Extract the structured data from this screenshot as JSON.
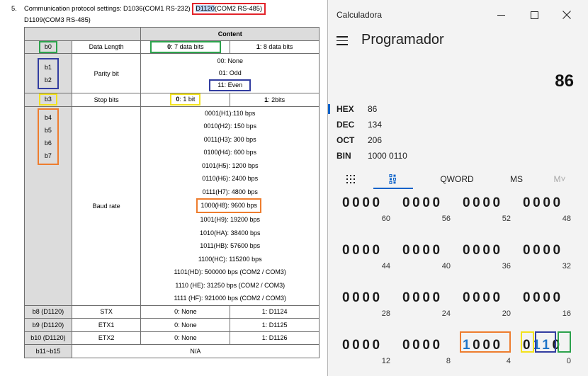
{
  "document": {
    "item_number": "5.",
    "intro_prefix": "Communication protocol settings: D1036(COM1 RS-232)",
    "intro_highlight_reg": "D1120",
    "intro_highlight_rest": "(COM2 RS-485)",
    "intro_line2": "D1109(COM3 RS-485)",
    "table": {
      "content_header": "Content",
      "b0": "b0",
      "data_length_label": "Data Length",
      "data_length_0": ": 7 data bits",
      "data_length_1": ": 8 data bits",
      "bit_zero": "0",
      "bit_one": "1",
      "b1": "b1",
      "b2": "b2",
      "parity_label": "Parity bit",
      "parity_options": [
        "00: None",
        "01: Odd",
        "11: Even"
      ],
      "b3": "b3",
      "stop_label": "Stop bits",
      "stop_0": ": 1 bit",
      "stop_1": ": 2bits",
      "b4": "b4",
      "b5": "b5",
      "b6": "b6",
      "b7": "b7",
      "baud_label": "Baud rate",
      "baud_rates": [
        "0001(H1):110 bps",
        "0010(H2): 150 bps",
        "0011(H3): 300 bps",
        "0100(H4): 600 bps",
        "0101(H5): 1200 bps",
        "0110(H6): 2400 bps",
        "0111(H7): 4800 bps",
        "1000(H8): 9600 bps",
        "1001(H9): 19200 bps",
        "1010(HA): 38400 bps",
        "1011(HB): 57600 bps",
        "1100(HC): 115200 bps",
        "1101(HD): 500000 bps (COM2 / COM3)",
        "1110 (HE): 31250 bps (COM2 / COM3)",
        "1111 (HF): 921000 bps (COM2 / COM3)"
      ],
      "rows_extra": [
        {
          "bit": "b8 (D1120)",
          "name": "STX",
          "zero": "0: None",
          "one": "1: D1124"
        },
        {
          "bit": "b9 (D1120)",
          "name": "ETX1",
          "zero": "0: None",
          "one": "1: D1125"
        },
        {
          "bit": "b10 (D1120)",
          "name": "ETX2",
          "zero": "0: None",
          "one": "1: D1126"
        }
      ],
      "b11_b15": "b11~b15",
      "na": "N/A"
    }
  },
  "calculator": {
    "window_title": "Calculadora",
    "mode_title": "Programador",
    "display_value": "86",
    "radix": [
      {
        "name": "HEX",
        "value": "86"
      },
      {
        "name": "DEC",
        "value": "134"
      },
      {
        "name": "OCT",
        "value": "206"
      },
      {
        "name": "BIN",
        "value": "1000 0110"
      }
    ],
    "tabs": {
      "keypad_icon": "keypad-icon",
      "bit_toggle_icon": "bit-toggle-icon",
      "word_size": "QWORD",
      "memory_store": "MS",
      "memory_recall": "M˅"
    },
    "bit_rows": [
      {
        "nibbles": [
          "0000",
          "0000",
          "0000",
          "0000"
        ],
        "positions": [
          "60",
          "56",
          "52",
          "48"
        ]
      },
      {
        "nibbles": [
          "0000",
          "0000",
          "0000",
          "0000"
        ],
        "positions": [
          "44",
          "40",
          "36",
          "32"
        ]
      },
      {
        "nibbles": [
          "0000",
          "0000",
          "0000",
          "0000"
        ],
        "positions": [
          "28",
          "24",
          "20",
          "16"
        ]
      },
      {
        "nibbles": [
          "0000",
          "0000",
          "1000",
          "0110"
        ],
        "positions": [
          "12",
          "8",
          "4",
          "0"
        ]
      }
    ],
    "highlight_colors": {
      "green": "#2ca24c",
      "blue": "#323da0",
      "yellow": "#f3e21d",
      "orange": "#ee7d2e",
      "red": "#e2242b",
      "accent": "#0b62c9"
    }
  }
}
